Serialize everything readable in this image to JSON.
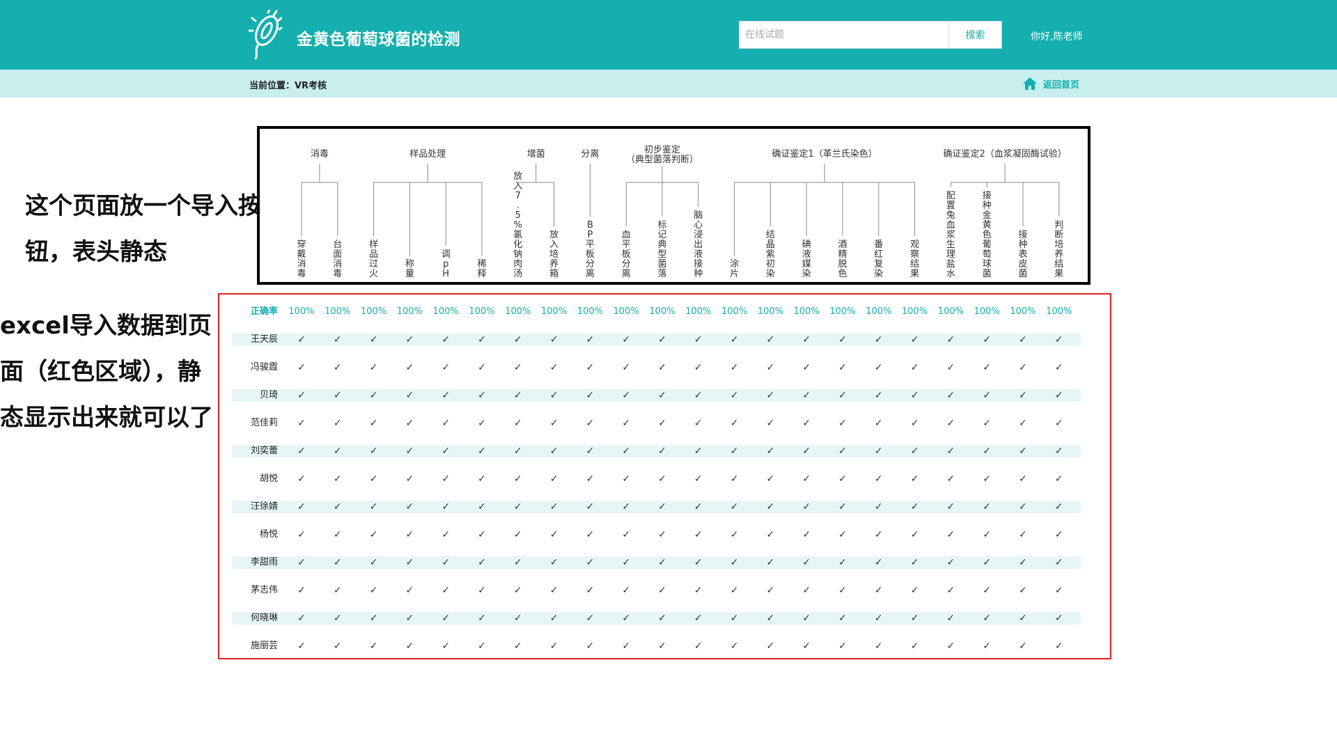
{
  "header": {
    "site_title": "金黄色葡萄球菌的检测",
    "search_placeholder": "在线试题",
    "search_button": "搜索",
    "greeting": "你好,陈老师"
  },
  "breadcrumb": {
    "label": "当前位置：VR考核",
    "home_link": "返回首页"
  },
  "annotations": {
    "note_header": "这个页面放一个导入按钮，表头静态",
    "note_data": "excel导入数据到页面（红色区域），静态显示出来就可以了"
  },
  "table_header": {
    "groups": [
      {
        "label": "消毒"
      },
      {
        "label": "样品处理"
      },
      {
        "label": "增菌"
      },
      {
        "label": "分离"
      },
      {
        "label": "初步鉴定（典型菌落判断）"
      },
      {
        "label": "确证鉴定1（革兰氏染色）"
      },
      {
        "label": "确证鉴定2（血浆凝固酶试验）"
      }
    ],
    "steps": [
      "穿戴消毒",
      "台面消毒",
      "样品过火",
      "称量",
      "调pH",
      "稀释",
      "放入7.5%氯化钠肉汤",
      "放入培养箱",
      "BP平板分离",
      "血平板分离",
      "标记典型菌落",
      "脑心浸出液接种",
      "涂片",
      "结晶紫初染",
      "碘液媒染",
      "酒精脱色",
      "番红复染",
      "观察结果",
      "配置兔血浆生理盐水",
      "接种金黄色葡萄球菌",
      "接种表皮菌",
      "判断培养结果"
    ]
  },
  "grid": {
    "accuracy_label": "正确率",
    "accuracy": [
      "100%",
      "100%",
      "100%",
      "100%",
      "100%",
      "100%",
      "100%",
      "100%",
      "100%",
      "100%",
      "100%",
      "100%",
      "100%",
      "100%",
      "100%",
      "100%",
      "100%",
      "100%",
      "100%",
      "100%",
      "100%",
      "100%"
    ],
    "check_mark": "✓",
    "students": [
      "王天辰",
      "冯骏霞",
      "贝琦",
      "范佳莉",
      "刘奕蕾",
      "胡悦",
      "汪徐婧",
      "杨悦",
      "李甜雨",
      "茅志伟",
      "何晓琳",
      "施丽芸"
    ]
  },
  "colors": {
    "brand": "#14afae",
    "crumb_bg": "#c8eeee",
    "row_shade": "#e6f5f6",
    "frame_red": "#e21f26"
  }
}
